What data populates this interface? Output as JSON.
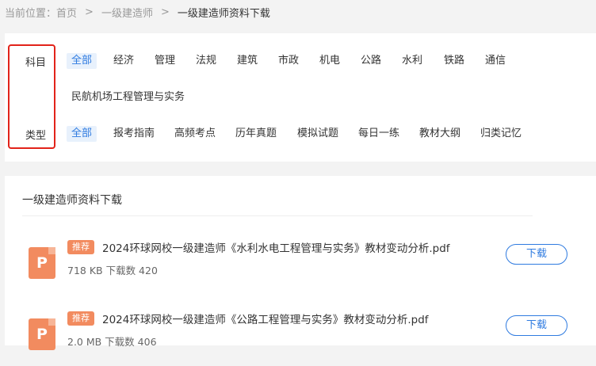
{
  "breadcrumb": {
    "prefix": "当前位置：",
    "home": "首页",
    "sep": ">",
    "level1": "一级建造师",
    "current": "一级建造师资料下载"
  },
  "filters": {
    "subject": {
      "label": "科目",
      "options": [
        "全部",
        "经济",
        "管理",
        "法规",
        "建筑",
        "市政",
        "机电",
        "公路",
        "水利",
        "铁路",
        "通信",
        "民航机场工程管理与实务"
      ]
    },
    "type": {
      "label": "类型",
      "options": [
        "全部",
        "报考指南",
        "高频考点",
        "历年真题",
        "模拟试题",
        "每日一练",
        "教材大纲",
        "归类记忆"
      ]
    }
  },
  "list": {
    "title": "一级建造师资料下载",
    "items": [
      {
        "badge": "推荐",
        "icon_letter": "P",
        "name": "2024环球网校一级建造师《水利水电工程管理与实务》教材变动分析.pdf",
        "meta": "718 KB 下载数 420",
        "button": "下载"
      },
      {
        "badge": "推荐",
        "icon_letter": "P",
        "name": "2024环球网校一级建造师《公路工程管理与实务》教材变动分析.pdf",
        "meta": "2.0 MB 下载数 406",
        "button": "下载"
      }
    ]
  },
  "colors": {
    "accent": "#2f7be0",
    "highlight_box": "#e2231a",
    "pdf_icon": "#f28b5f"
  }
}
